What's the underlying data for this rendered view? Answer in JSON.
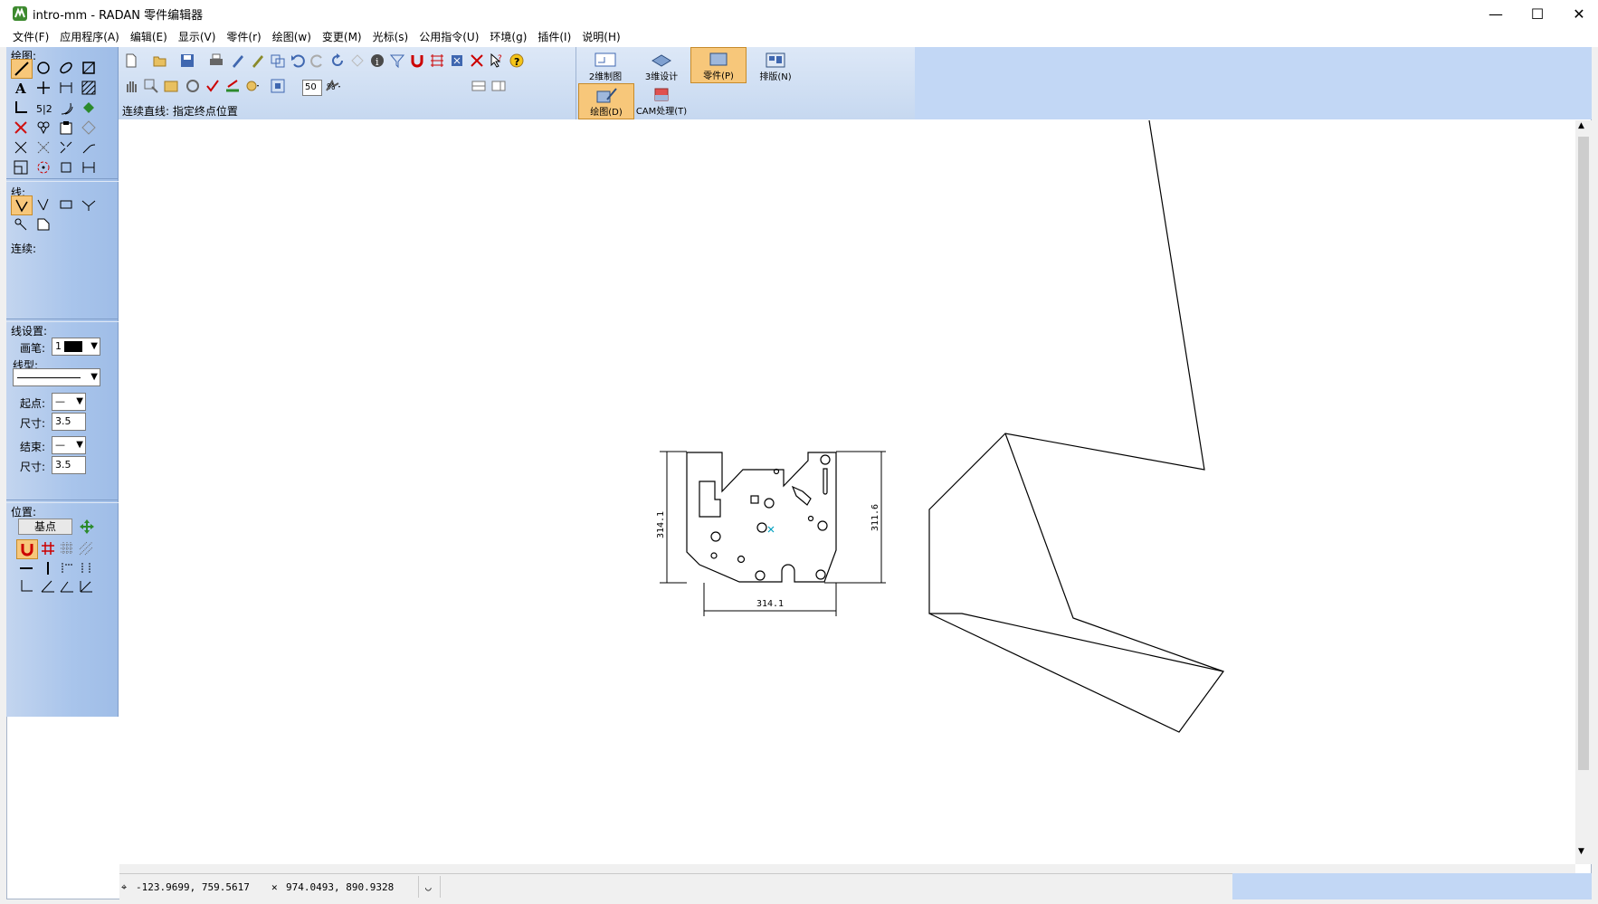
{
  "window": {
    "title": "intro-mm - RADAN 零件编辑器",
    "minimize_glyph": "—",
    "maximize_glyph": "☐",
    "close_glyph": "✕"
  },
  "menu": [
    "文件(F)",
    "应用程序(A)",
    "编辑(E)",
    "显示(V)",
    "零件(r)",
    "绘图(w)",
    "变更(M)",
    "光标(s)",
    "公用指令(U)",
    "环境(g)",
    "插件(I)",
    "说明(H)"
  ],
  "left_panel": {
    "drawing_label": "绘图:",
    "line_label": "线:",
    "continuous_label": "连续:",
    "line_settings_label": "线设置:",
    "pen_label": "画笔:",
    "pen_value": "1",
    "linetype_label": "线型:",
    "start_label": "起点:",
    "start_value": "—",
    "start_size_label": "尺寸:",
    "start_size_value": "3.5",
    "end_label": "结束:",
    "end_value": "—",
    "end_size_label": "尺寸:",
    "end_size_value": "3.5",
    "position_label": "位置:",
    "base_point_button": "基点"
  },
  "toolbar": {
    "zoom_value": "50",
    "zoom_unit": "%",
    "command_prompt": "连续直线:  指定终点位置"
  },
  "modes": {
    "design_2d": "2维制图",
    "design_3d": "3维设计",
    "part": "零件(P)",
    "nesting": "排版(N)",
    "drawing": "绘图(D)",
    "cam": "CAM处理(T)"
  },
  "drawing": {
    "dim_left": "314.1",
    "dim_right": "311.6",
    "dim_bottom": "314.1"
  },
  "status": {
    "cursor_coords": "-123.9699,  759.5617",
    "point_coords": "974.0493,  890.9328"
  },
  "colors": {
    "panel_blue": "#a8c4eb",
    "active_orange": "#f7c77a",
    "marker_cyan": "#00a0c0"
  }
}
